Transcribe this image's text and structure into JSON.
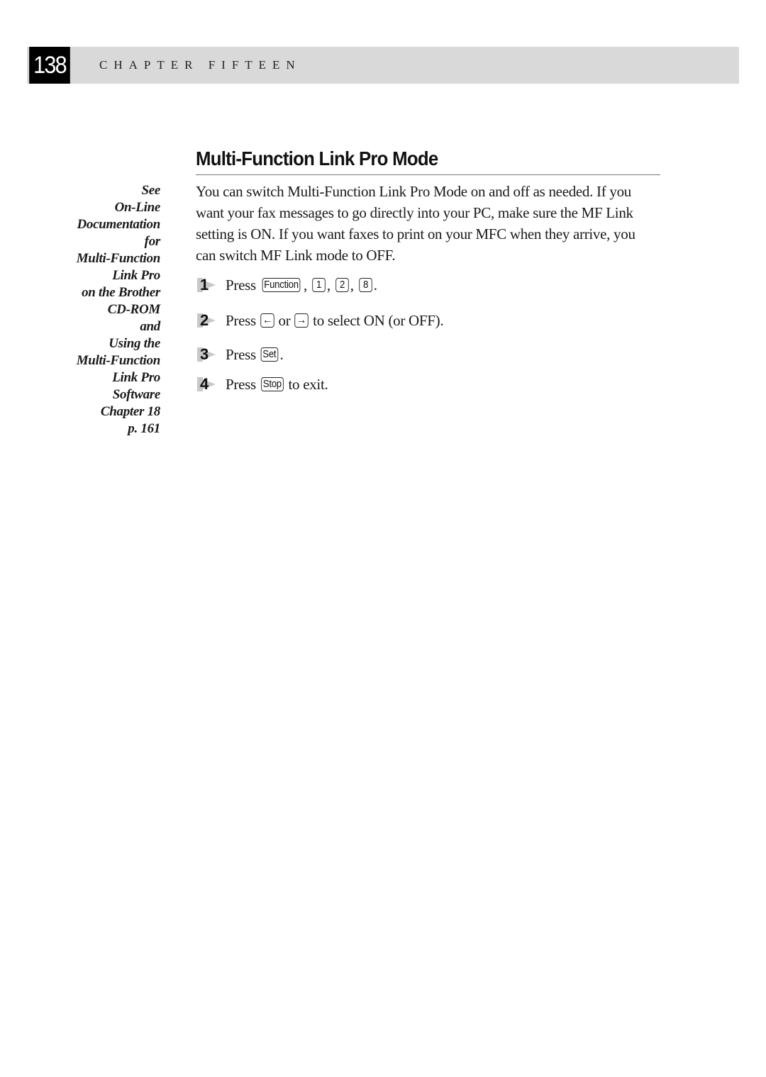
{
  "header": {
    "page_number": "138",
    "chapter_label": "CHAPTER FIFTEEN"
  },
  "sidebar_note": {
    "lines": [
      "See",
      "On-Line",
      "Documentation",
      "for",
      "Multi-Function",
      "Link Pro",
      "on the Brother",
      "CD-ROM",
      "and",
      "Using the",
      "Multi-Function",
      "Link Pro",
      "Software",
      "Chapter 18",
      "p. 161"
    ]
  },
  "section": {
    "title": "Multi-Function Link Pro Mode",
    "paragraph_lines": [
      "You can switch Multi-Function Link Pro Mode on and off as needed. If you",
      "want your fax messages to go directly into your PC, make sure the MF Link",
      "setting is ON. If you want faxes to print on your MFC when they arrive, you",
      "can switch MF Link mode to OFF."
    ]
  },
  "steps": [
    {
      "number": "1",
      "press": "Press",
      "keys": [
        "Function",
        "1",
        "2",
        "8"
      ],
      "sep": ",",
      "end": "."
    },
    {
      "number": "2",
      "press": "Press",
      "key_left": "←",
      "or": "or",
      "key_right": "→",
      "rest": "to select ON (or OFF)."
    },
    {
      "number": "3",
      "press": "Press",
      "key": "Set",
      "end": "."
    },
    {
      "number": "4",
      "press": "Press",
      "key": "Stop",
      "rest": "to exit."
    }
  ]
}
